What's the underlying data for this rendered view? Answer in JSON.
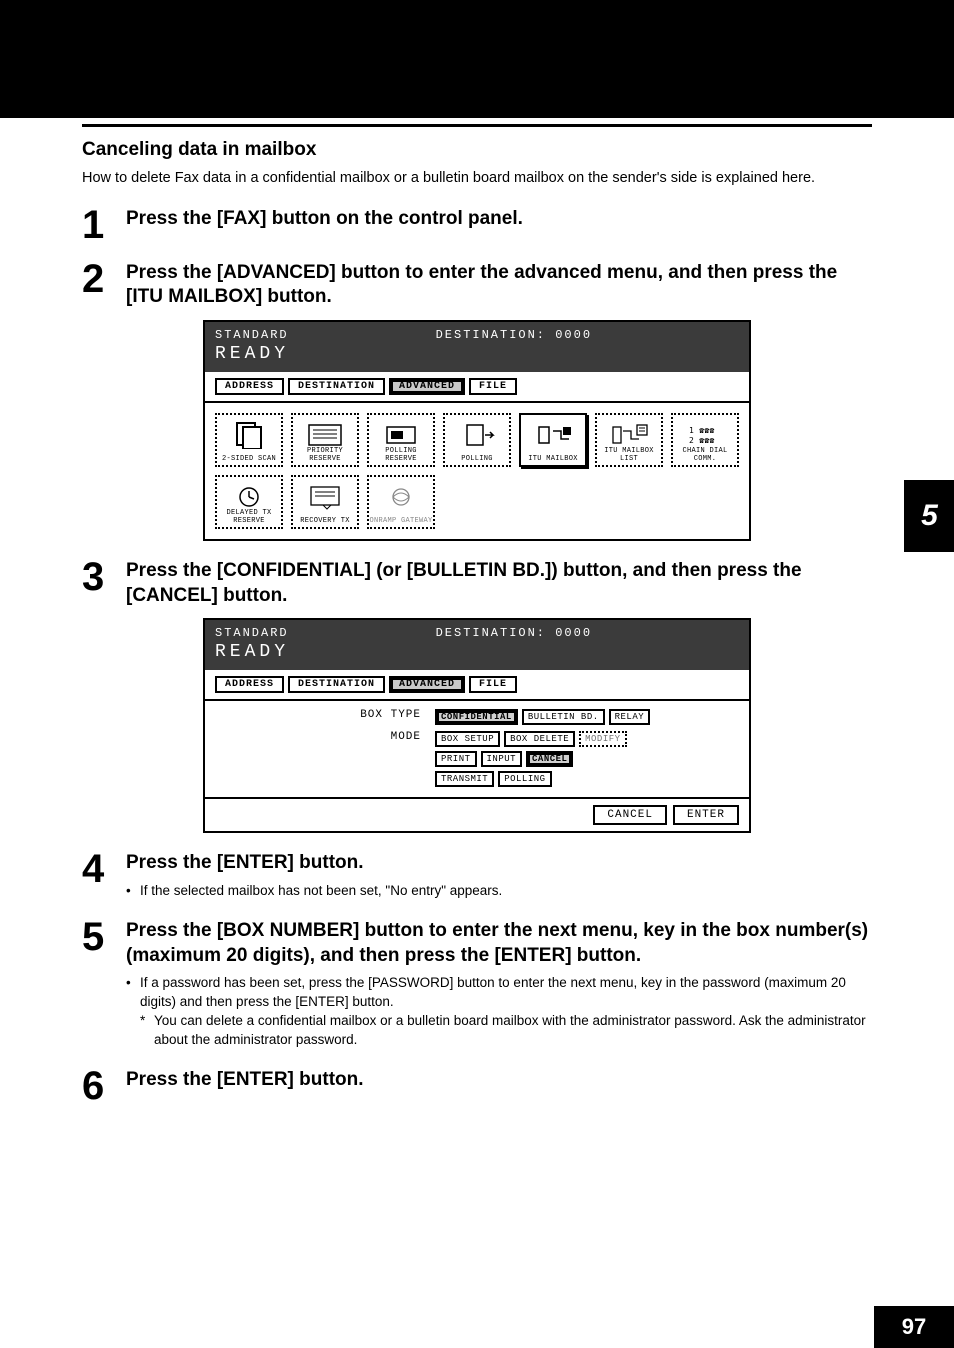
{
  "chapter": "5",
  "pageNumber": "97",
  "sectionTitle": "Canceling data in mailbox",
  "intro": "How to delete Fax data in a confidential mailbox or a bulletin board mailbox on the sender's side is explained here.",
  "steps": {
    "s1": {
      "num": "1",
      "title": "Press the [FAX] button on the control panel."
    },
    "s2": {
      "num": "2",
      "title": "Press the [ADVANCED] button to enter the advanced menu, and then press the [ITU MAILBOX] button."
    },
    "s3": {
      "num": "3",
      "title": "Press the [CONFIDENTIAL] (or [BULLETIN BD.]) button, and then press the [CANCEL] button."
    },
    "s4": {
      "num": "4",
      "title": "Press the [ENTER] button.",
      "sub_bullet": "If the selected mailbox has not been set, \"No entry\" appears."
    },
    "s5": {
      "num": "5",
      "title": "Press the [BOX NUMBER] button to enter the next menu, key in the box number(s) (maximum 20 digits), and then press the [ENTER] button.",
      "sub_bullet": "If a password has been set, press the [PASSWORD] button to enter the next menu, key in the password (maximum 20 digits) and then press the [ENTER] button.",
      "sub_star": "You can delete a confidential mailbox or a bulletin board mailbox with the administrator password. Ask the administrator about the administrator password."
    },
    "s6": {
      "num": "6",
      "title": "Press the [ENTER] button."
    }
  },
  "faxScreen1": {
    "resLabel": "STANDARD",
    "destLabel": "DESTINATION: 0000",
    "ready": "READY",
    "tabs": {
      "t1": "ADDRESS",
      "t2": "DESTINATION",
      "t3": "ADVANCED",
      "t4": "FILE"
    },
    "buttons": {
      "b1": "2-SIDED SCAN",
      "b2": "PRIORITY RESERVE",
      "b3": "POLLING RESERVE",
      "b4": "POLLING",
      "b5": "ITU MAILBOX",
      "b6": "ITU MAILBOX LIST",
      "b7": "CHAIN DIAL COMM.",
      "b8": "DELAYED TX RESERVE",
      "b9": "RECOVERY TX",
      "b10": "ONRAMP GATEWAY"
    }
  },
  "faxScreen2": {
    "resLabel": "STANDARD",
    "destLabel": "DESTINATION: 0000",
    "ready": "READY",
    "tabs": {
      "t1": "ADDRESS",
      "t2": "DESTINATION",
      "t3": "ADVANCED",
      "t4": "FILE"
    },
    "row1Label": "BOX TYPE",
    "row2Label": "MODE",
    "boxTypes": {
      "b1": "CONFIDENTIAL",
      "b2": "BULLETIN BD.",
      "b3": "RELAY"
    },
    "modesRow1": {
      "m1": "BOX SETUP",
      "m2": "BOX DELETE",
      "m3": "MODIFY"
    },
    "modesRow2": {
      "m4": "PRINT",
      "m5": "INPUT",
      "m6": "CANCEL"
    },
    "modesRow3": {
      "m7": "TRANSMIT",
      "m8": "POLLING"
    },
    "footer": {
      "cancel": "CANCEL",
      "enter": "ENTER"
    }
  }
}
